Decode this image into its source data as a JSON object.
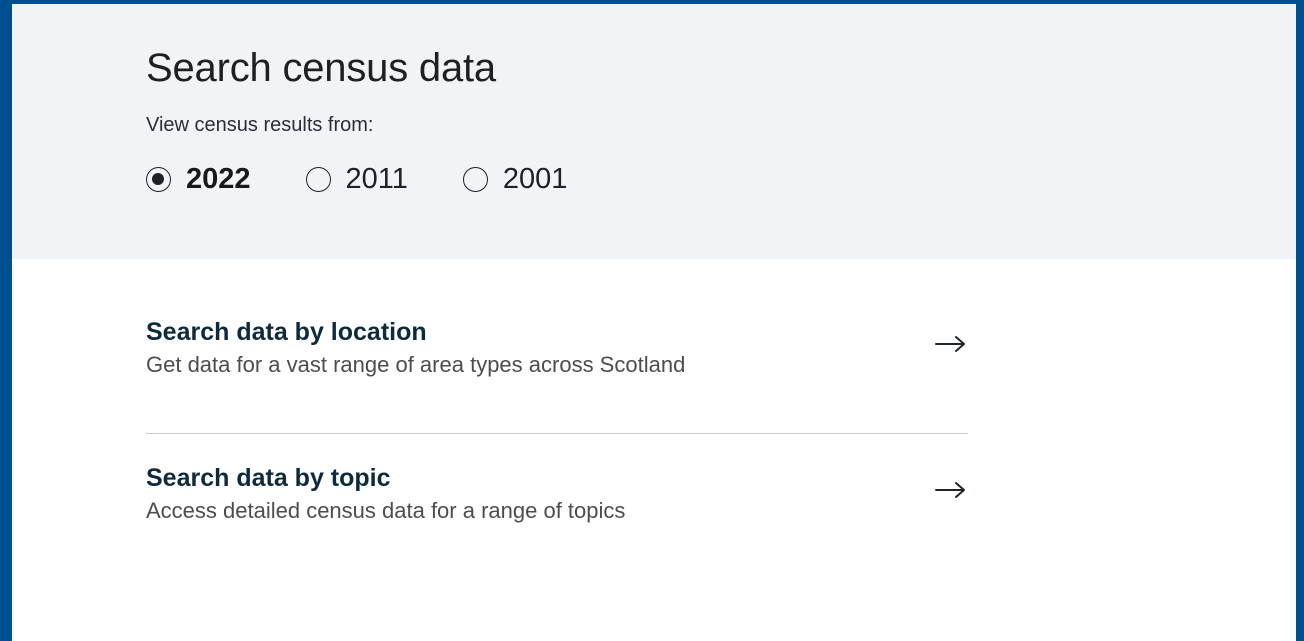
{
  "header": {
    "title": "Search census data",
    "results_label": "View census results from:",
    "years": [
      {
        "label": "2022",
        "selected": true
      },
      {
        "label": "2011",
        "selected": false
      },
      {
        "label": "2001",
        "selected": false
      }
    ]
  },
  "links": [
    {
      "title": "Search data by location",
      "description": "Get data for a vast range of area types across Scotland",
      "icon": "arrow-right-icon"
    },
    {
      "title": "Search data by topic",
      "description": "Access detailed census data for a range of topics",
      "icon": "arrow-right-icon"
    }
  ],
  "colors": {
    "frame_border": "#00508f",
    "hero_background": "#f1f4f6",
    "heading_text": "#0d2b3d",
    "divider": "#c9ccd0"
  }
}
